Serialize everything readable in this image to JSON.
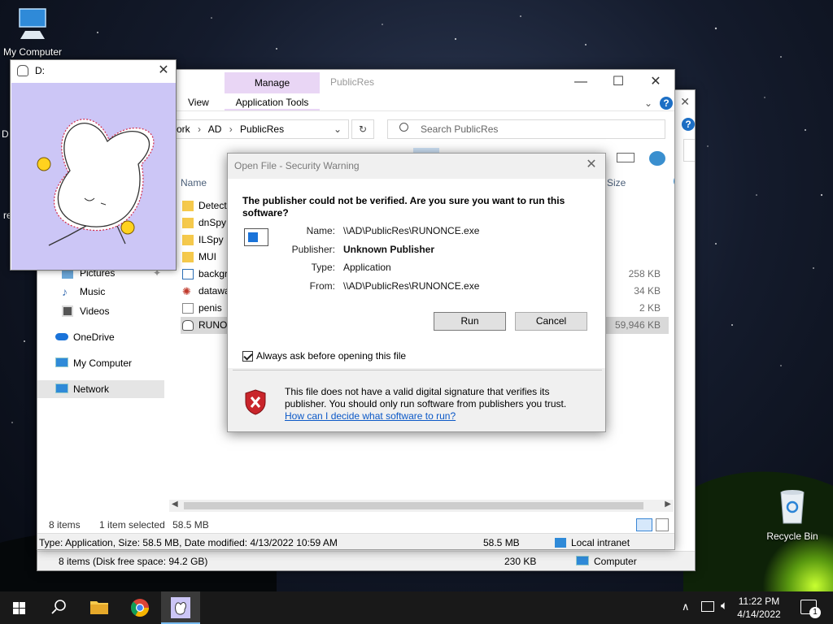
{
  "desktop": {
    "icons": [
      {
        "label": "My Computer"
      },
      {
        "label": "Recycle Bin"
      }
    ],
    "clipped_labels": [
      "D",
      "re"
    ]
  },
  "floating_window": {
    "title": "D:"
  },
  "explorer_front": {
    "ribbon": {
      "manage_tab": "Manage",
      "app_tools_tab": "Application Tools",
      "view_tab": "View",
      "window_title": "PublicRes"
    },
    "address_parts": [
      "ork",
      "AD",
      "PublicRes"
    ],
    "search_placeholder": "Search PublicRes",
    "columns": {
      "name": "Name",
      "size": "Size"
    },
    "sidebar": [
      {
        "label": "Pictures"
      },
      {
        "label": "Music"
      },
      {
        "label": "Videos"
      },
      {
        "label": "OneDrive"
      },
      {
        "label": "My Computer"
      },
      {
        "label": "Network",
        "selected": true
      }
    ],
    "files": [
      {
        "name": "Detect",
        "size": "",
        "type": "folder"
      },
      {
        "name": "dnSpy",
        "size": "",
        "type": "folder"
      },
      {
        "name": "ILSpy",
        "size": "",
        "type": "folder"
      },
      {
        "name": "MUI",
        "size": "",
        "type": "folder"
      },
      {
        "name": "backgr",
        "size": "258 KB",
        "type": "image"
      },
      {
        "name": "datawa",
        "size": "34 KB",
        "type": "gear"
      },
      {
        "name": "penis",
        "size": "2 KB",
        "type": "text"
      },
      {
        "name": "RUNON",
        "size": "59,946 KB",
        "type": "exe",
        "selected": true
      }
    ],
    "status": {
      "items": "8 items",
      "selected": "1 item selected",
      "size": "58.5 MB"
    },
    "details_bar": {
      "info": "Type: Application, Size: 58.5 MB, Date modified: 4/13/2022 10:59 AM",
      "size": "58.5 MB",
      "zone": "Local intranet"
    }
  },
  "explorer_back": {
    "status": {
      "items": "8 items (Disk free space: 94.2 GB)",
      "size": "230 KB",
      "location": "Computer"
    }
  },
  "dialog": {
    "title": "Open File - Security Warning",
    "question": "The publisher could not be verified.  Are you sure you want to run this software?",
    "fields": [
      {
        "label": "Name:",
        "value": "\\\\AD\\PublicRes\\RUNONCE.exe",
        "bold": false
      },
      {
        "label": "Publisher:",
        "value": "Unknown Publisher",
        "bold": true
      },
      {
        "label": "Type:",
        "value": "Application",
        "bold": false
      },
      {
        "label": "From:",
        "value": "\\\\AD\\PublicRes\\RUNONCE.exe",
        "bold": false
      }
    ],
    "run_button": "Run",
    "cancel_button": "Cancel",
    "checkbox_label": "Always ask before opening this file",
    "checkbox_checked": true,
    "warning_text": "This file does not have a valid digital signature that verifies its publisher.  You should only run software from publishers you trust.",
    "help_link": "How can I decide what software to run?"
  },
  "taskbar": {
    "time": "11:22 PM",
    "date": "4/14/2022",
    "notification_count": "1"
  },
  "colors": {
    "manage_tab": "#e9d6f5",
    "link": "#0b58c7",
    "pane_lavender": "#ccc6f6",
    "taskbar": "#191919"
  }
}
